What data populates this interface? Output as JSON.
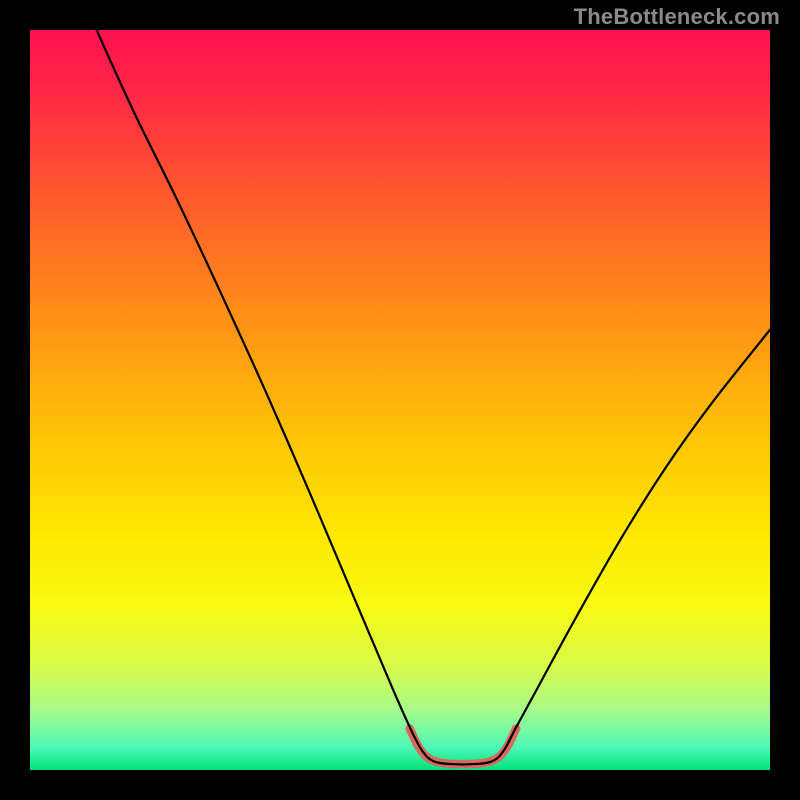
{
  "watermark": "TheBottleneck.com",
  "chart_data": {
    "type": "line",
    "title": "",
    "xlabel": "",
    "ylabel": "",
    "xlim": [
      0,
      100
    ],
    "ylim": [
      0,
      100
    ],
    "background_gradient_stops": [
      {
        "offset": 0.0,
        "color": "#ff1251"
      },
      {
        "offset": 0.07,
        "color": "#ff2247"
      },
      {
        "offset": 0.18,
        "color": "#ff4a34"
      },
      {
        "offset": 0.3,
        "color": "#ff7322"
      },
      {
        "offset": 0.42,
        "color": "#ff9a12"
      },
      {
        "offset": 0.55,
        "color": "#ffc406"
      },
      {
        "offset": 0.68,
        "color": "#ffe702"
      },
      {
        "offset": 0.78,
        "color": "#f7fa12"
      },
      {
        "offset": 0.86,
        "color": "#d8fb4a"
      },
      {
        "offset": 0.92,
        "color": "#a6fb8b"
      },
      {
        "offset": 0.97,
        "color": "#4df7b7"
      },
      {
        "offset": 1.0,
        "color": "#00e47a"
      }
    ],
    "series": [
      {
        "name": "bottleneck-curve",
        "stroke": "#000000",
        "stroke_width": 2.2,
        "points": [
          {
            "x": 9.0,
            "y": 100.0
          },
          {
            "x": 14.0,
            "y": 89.0
          },
          {
            "x": 20.0,
            "y": 76.8
          },
          {
            "x": 26.0,
            "y": 64.0
          },
          {
            "x": 32.0,
            "y": 50.8
          },
          {
            "x": 38.0,
            "y": 37.0
          },
          {
            "x": 44.0,
            "y": 22.8
          },
          {
            "x": 49.0,
            "y": 11.0
          },
          {
            "x": 51.5,
            "y": 5.4
          },
          {
            "x": 53.0,
            "y": 2.6
          },
          {
            "x": 54.5,
            "y": 1.2
          },
          {
            "x": 57.0,
            "y": 0.8
          },
          {
            "x": 60.0,
            "y": 0.8
          },
          {
            "x": 62.5,
            "y": 1.2
          },
          {
            "x": 64.0,
            "y": 2.6
          },
          {
            "x": 65.5,
            "y": 5.4
          },
          {
            "x": 68.0,
            "y": 10.0
          },
          {
            "x": 74.0,
            "y": 21.0
          },
          {
            "x": 80.0,
            "y": 31.5
          },
          {
            "x": 86.0,
            "y": 41.0
          },
          {
            "x": 92.0,
            "y": 49.4
          },
          {
            "x": 100.0,
            "y": 59.5
          }
        ]
      },
      {
        "name": "valley-highlight",
        "stroke": "#d9695d",
        "stroke_width": 8.5,
        "linecap": "round",
        "points": [
          {
            "x": 51.3,
            "y": 5.6
          },
          {
            "x": 52.6,
            "y": 3.0
          },
          {
            "x": 54.0,
            "y": 1.5
          },
          {
            "x": 56.0,
            "y": 0.9
          },
          {
            "x": 58.5,
            "y": 0.8
          },
          {
            "x": 61.0,
            "y": 0.9
          },
          {
            "x": 63.0,
            "y": 1.5
          },
          {
            "x": 64.4,
            "y": 3.0
          },
          {
            "x": 65.7,
            "y": 5.6
          }
        ]
      }
    ]
  }
}
